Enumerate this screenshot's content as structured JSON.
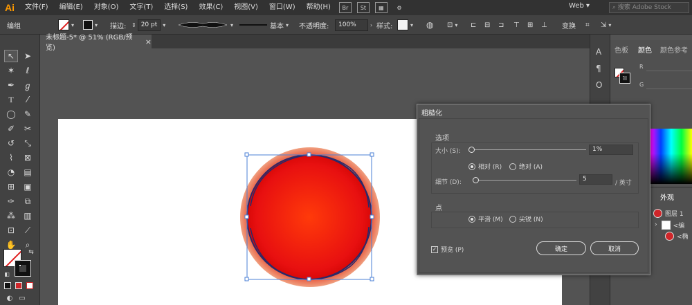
{
  "app": {
    "logo": "Ai"
  },
  "menubar": {
    "items": [
      "文件(F)",
      "编辑(E)",
      "对象(O)",
      "文字(T)",
      "选择(S)",
      "效果(C)",
      "视图(V)",
      "窗口(W)",
      "帮助(H)"
    ],
    "bridge": "Br",
    "stock": "St",
    "workspace": "Web",
    "search_placeholder": "搜索 Adobe Stock"
  },
  "controlbar": {
    "mode_label": "编组",
    "stroke_label": "描边:",
    "stroke_value": "20 pt",
    "profile_label": "基本",
    "opacity_label": "不透明度:",
    "opacity_value": "100%",
    "style_label": "样式:",
    "transform_label": "变换"
  },
  "document_tab": {
    "title": "未标题-5* @ 51% (RGB/预览)",
    "close": "×"
  },
  "dialog": {
    "title": "粗糙化",
    "options_group": "选项",
    "size_label": "大小 (S):",
    "size_value": "1%",
    "relative_label": "相对 (R)",
    "absolute_label": "绝对 (A)",
    "detail_label": "细节 (D):",
    "detail_value": "5",
    "detail_unit": "/ 英寸",
    "point_group": "点",
    "smooth_label": "平滑 (M)",
    "corner_label": "尖锐 (N)",
    "preview_label": "预览 (P)",
    "ok_label": "确定",
    "cancel_label": "取消"
  },
  "panels": {
    "color_tab": "色板",
    "color_active_tab": "颜色",
    "color_ref_tab": "颜色参考",
    "channels": [
      "R",
      "G"
    ],
    "appearance_tab": "外观",
    "layer_name": "图层 1",
    "layer_items": [
      "<编",
      "<椭"
    ]
  },
  "colors": {
    "accent": "#ff9a00",
    "circle_center": "#ff3a0a",
    "circle_edge": "#d80808",
    "path_stroke": "#2a2a6a",
    "selection": "#4a7fd6"
  }
}
